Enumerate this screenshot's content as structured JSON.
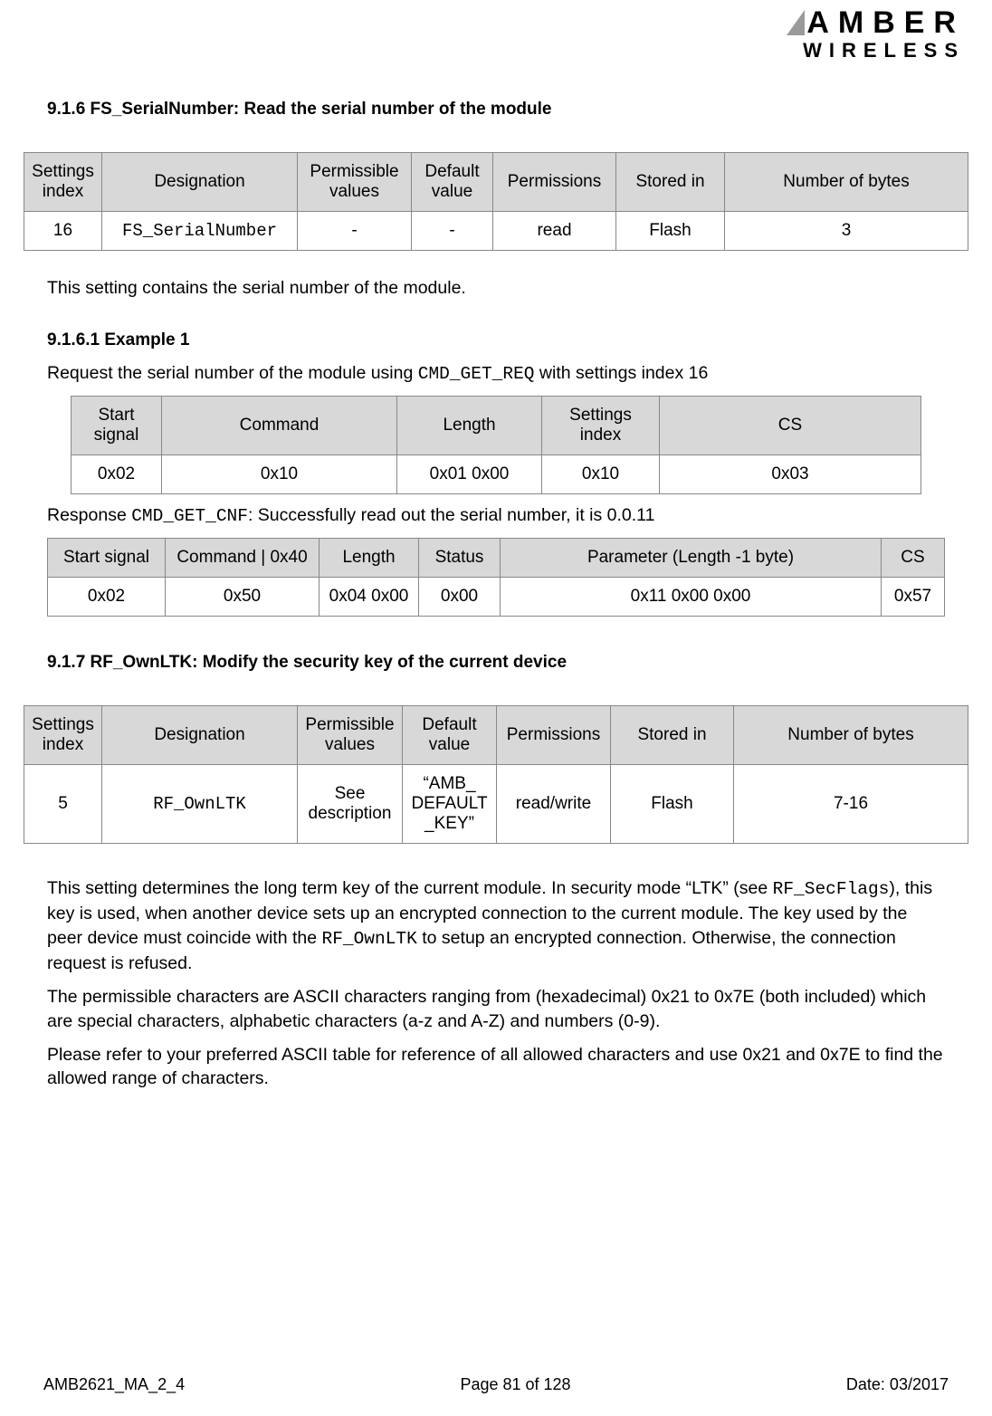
{
  "logo": {
    "line1": "AMBER",
    "line2": "WIRELESS"
  },
  "section1": {
    "heading": "9.1.6 FS_SerialNumber: Read the serial number of the module",
    "table": {
      "headers": [
        "Settings index",
        "Designation",
        "Permissible values",
        "Default value",
        "Permissions",
        "Stored in",
        "Number of bytes"
      ],
      "row": {
        "index": "16",
        "designation": "FS_SerialNumber",
        "permissible": "-",
        "default": "-",
        "permissions": "read",
        "stored_in": "Flash",
        "bytes": "3"
      }
    },
    "description": "This setting contains the serial number of the module.",
    "example": {
      "heading": "9.1.6.1    Example 1",
      "request_text_1": "Request the serial number of the module using ",
      "request_cmd": "CMD_GET_REQ",
      "request_text_2": " with settings index 16",
      "req_table": {
        "headers": [
          "Start signal",
          "Command",
          "Length",
          "Settings index",
          "CS"
        ],
        "row": [
          "0x02",
          "0x10",
          "0x01 0x00",
          "0x10",
          "0x03"
        ]
      },
      "response_text_1": "Response ",
      "response_cmd": "CMD_GET_CNF",
      "response_text_2": ": Successfully read out the serial number, it is 0.0.11",
      "resp_table": {
        "headers": [
          "Start signal",
          "Command | 0x40",
          "Length",
          "Status",
          "Parameter (Length -1 byte)",
          "CS"
        ],
        "row": [
          "0x02",
          "0x50",
          "0x04 0x00",
          "0x00",
          "0x11 0x00 0x00",
          "0x57"
        ]
      }
    }
  },
  "section2": {
    "heading": "9.1.7 RF_OwnLTK: Modify the security key of the current device",
    "table": {
      "headers": [
        "Settings index",
        "Designation",
        "Permissible values",
        "Default value",
        "Permissions",
        "Stored in",
        "Number of bytes"
      ],
      "row": {
        "index": "5",
        "designation": "RF_OwnLTK",
        "permissible": "See description",
        "default": "“AMB_ DEFAULT _KEY”",
        "permissions": "read/write",
        "stored_in": "Flash",
        "bytes": "7-16"
      }
    },
    "para1_a": "This setting determines the long term key of the current module. In security mode “LTK” (see ",
    "para1_code1": "RF_SecFlags",
    "para1_b": "), this key is used, when another device sets up an encrypted connection to the current module. The key used by the peer device must coincide with the ",
    "para1_code2": "RF_OwnLTK",
    "para1_c": " to setup an encrypted connection. Otherwise, the connection request is refused.",
    "para2": "The permissible characters are ASCII characters ranging from (hexadecimal) 0x21 to 0x7E (both included) which are special characters, alphabetic characters (a-z and A-Z) and numbers (0-9).",
    "para3": "Please refer to your preferred ASCII table for reference of all allowed characters and use 0x21 and 0x7E to find the allowed range of characters."
  },
  "footer": {
    "left": "AMB2621_MA_2_4",
    "center": "Page 81 of 128",
    "right": "Date: 03/2017"
  }
}
